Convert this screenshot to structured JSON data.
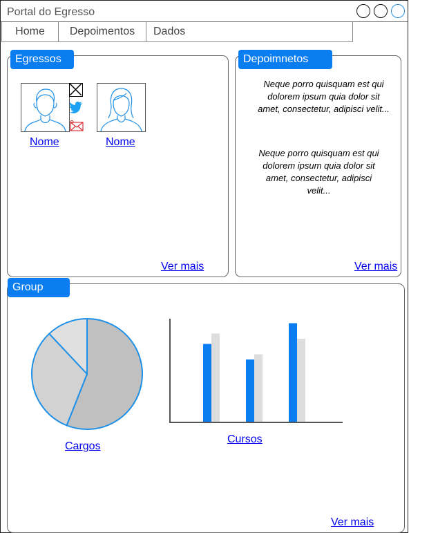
{
  "window": {
    "title": "Portal do Egresso"
  },
  "nav": {
    "tabs": [
      "Home",
      "Depoimentos",
      "Dados"
    ]
  },
  "egressos": {
    "title": "Egressos",
    "people": [
      {
        "name": "Nome"
      },
      {
        "name": "Nome"
      }
    ],
    "more": "Ver mais"
  },
  "depoimentos": {
    "title": "Depoimnetos",
    "quotes": [
      "Neque porro quisquam est qui dolorem ipsum quia dolor sit amet, consectetur, adipisci velit...",
      "Neque porro quisquam est qui dolorem ipsum quia dolor sit amet, consectetur, adipisci velit..."
    ],
    "more": "Ver mais"
  },
  "group": {
    "title": "Group",
    "pie_label": "Cargos",
    "bar_label": "Cursos",
    "more": "Ver mais"
  },
  "chart_data": [
    {
      "type": "pie",
      "values": [
        56,
        32,
        12
      ],
      "colors": [
        "#c0c0c0",
        "#d2d2d2",
        "#e0e0e0"
      ],
      "stroke": "#1e90e8"
    },
    {
      "type": "bar",
      "categories": [
        "",
        "",
        ""
      ],
      "series": [
        {
          "values": [
            75,
            60,
            95
          ],
          "color": "#0a7ef0"
        },
        {
          "values": [
            85,
            65,
            80
          ],
          "color": "#dddddd"
        }
      ],
      "ylim": [
        0,
        100
      ]
    }
  ]
}
